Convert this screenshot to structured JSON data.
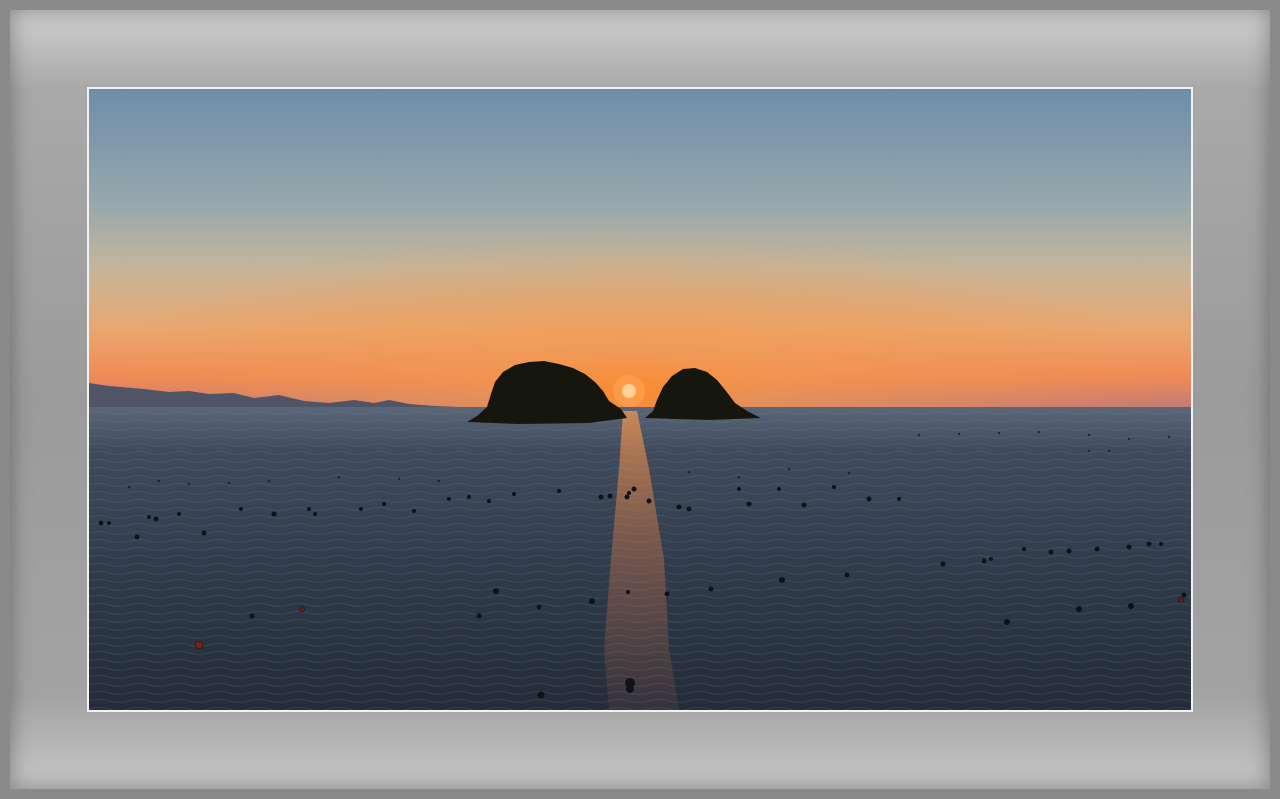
{
  "image": {
    "subject": "",
    "colors": {
      "sky_top": "#6f8fa8",
      "sky_mid": "#b9b4a6",
      "sky_glow": "#f3a266",
      "horizon_glow": "#f07a3a",
      "sun": "#fff4c8",
      "island": "#15170f",
      "sea": "#2f3a49",
      "frame": "#9b9b9b",
      "photo_border": "#f2f2f2"
    }
  }
}
